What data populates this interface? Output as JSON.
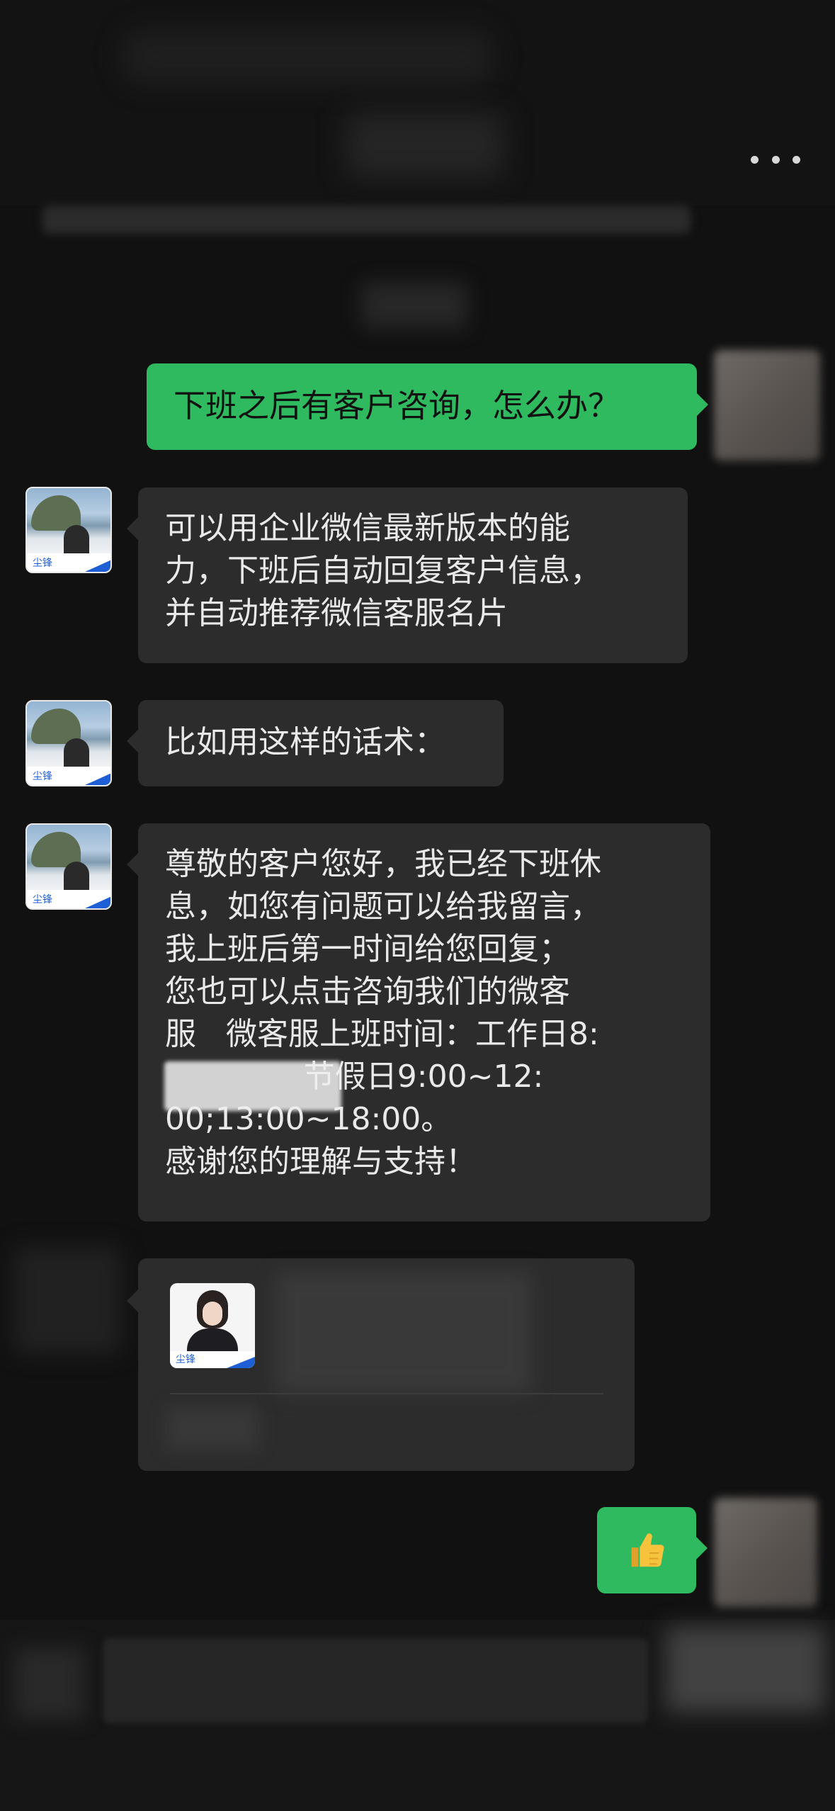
{
  "messages": {
    "m1": {
      "sender": "self",
      "text": "下班之后有客户咨询，怎么办？"
    },
    "m2": {
      "sender": "contact",
      "lines": [
        "可以用企业微信最新版本的能",
        "力，下班后自动回复客户信息，",
        "并自动推荐微信客服名片"
      ]
    },
    "m3": {
      "sender": "contact",
      "text": "比如用这样的话术："
    },
    "m4": {
      "sender": "contact",
      "lines": [
        "尊敬的客户您好，我已经下班休",
        "息，如您有问题可以给我留言，",
        "我上班后第一时间给您回复；",
        "您也可以点击咨询我们的微客",
        "服   微客服上班时间：工作日8:",
        "              节假日9:00~12:",
        "00;13:00~18:00。",
        "感谢您的理解与支持！"
      ]
    },
    "m6": {
      "sender": "self",
      "emoji": "👍"
    }
  },
  "avatar_tag_text": "尘锋",
  "icons": {
    "more": "more-horizontal-icon",
    "thumbs_up": "thumbs-up-icon"
  },
  "colors": {
    "background": "#111111",
    "incoming_bubble": "#2c2c2c",
    "outgoing_bubble": "#2fba5f",
    "brand_blue": "#1f5fd6"
  }
}
